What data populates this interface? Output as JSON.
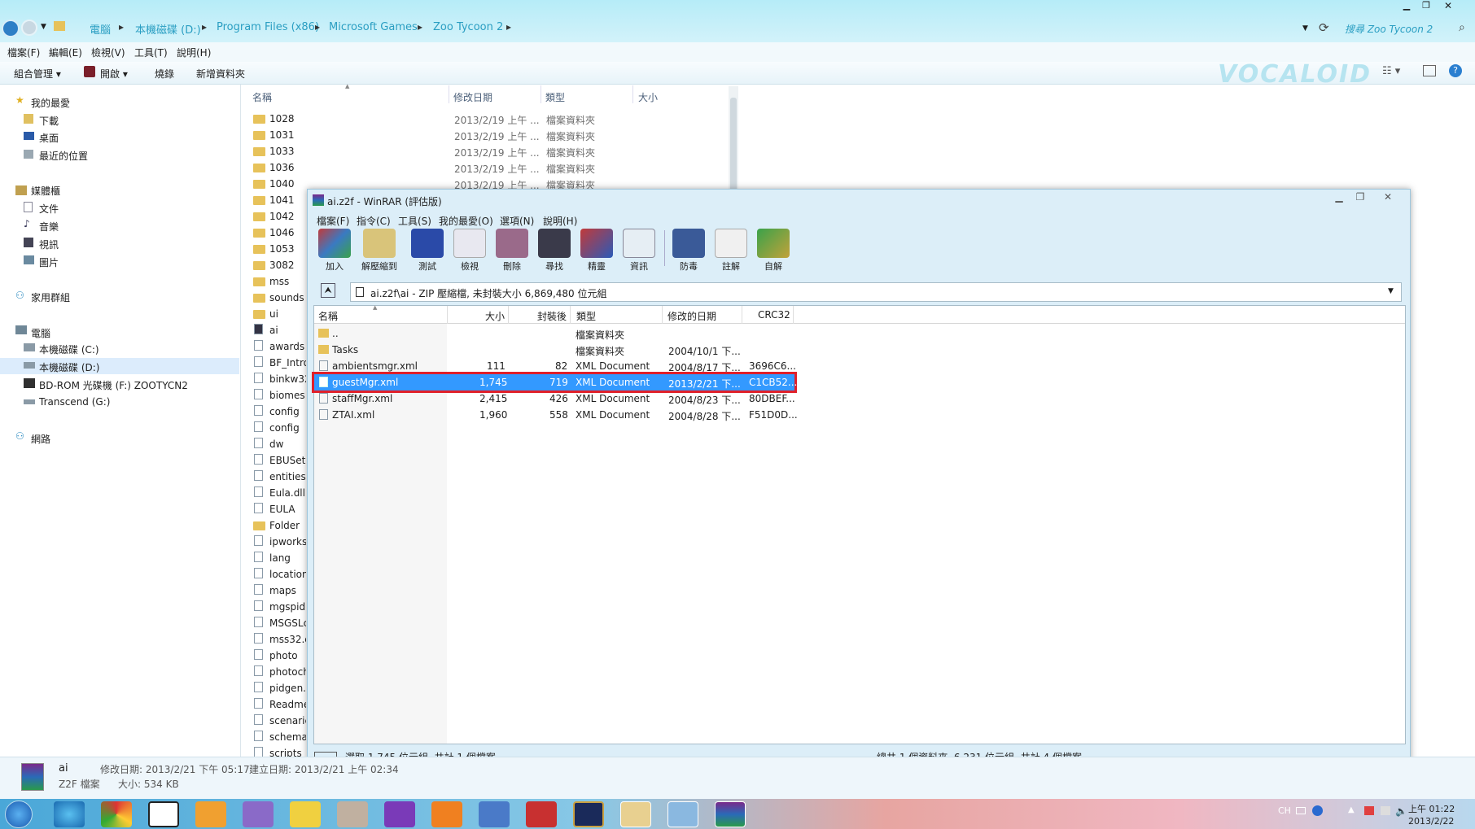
{
  "explorer": {
    "breadcrumb": [
      "電腦",
      "本機磁碟 (D:)",
      "Program Files (x86)",
      "Microsoft Games",
      "Zoo Tycoon 2"
    ],
    "search_placeholder": "搜尋 Zoo Tycoon 2",
    "menu": [
      "檔案(F)",
      "編輯(E)",
      "檢視(V)",
      "工具(T)",
      "說明(H)"
    ],
    "toolbar": {
      "organize": "組合管理",
      "open": "開啟",
      "burn": "燒錄",
      "new_folder": "新增資料夾"
    },
    "nav": {
      "favorites": "我的最愛",
      "downloads": "下載",
      "desktop": "桌面",
      "recent": "最近的位置",
      "libraries": "媒體櫃",
      "documents": "文件",
      "music": "音樂",
      "videos": "視訊",
      "pictures": "圖片",
      "homegroup": "家用群組",
      "computer": "電腦",
      "drive_c": "本機磁碟 (C:)",
      "drive_d": "本機磁碟 (D:)",
      "drive_f": "BD-ROM 光碟機 (F:) ZOOTYCN2",
      "drive_g": "Transcend (G:)",
      "network": "網路"
    },
    "columns": {
      "name": "名稱",
      "date": "修改日期",
      "type": "類型",
      "size": "大小"
    },
    "files": [
      {
        "name": "1028",
        "date": "2013/2/19 上午 ...",
        "type": "檔案資料夾"
      },
      {
        "name": "1031",
        "date": "2013/2/19 上午 ...",
        "type": "檔案資料夾"
      },
      {
        "name": "1033",
        "date": "2013/2/19 上午 ...",
        "type": "檔案資料夾"
      },
      {
        "name": "1036",
        "date": "2013/2/19 上午 ...",
        "type": "檔案資料夾"
      },
      {
        "name": "1040",
        "date": "2013/2/19 上午 ...",
        "type": "檔案資料夾"
      },
      {
        "name": "1041"
      },
      {
        "name": "1042"
      },
      {
        "name": "1046"
      },
      {
        "name": "1053"
      },
      {
        "name": "3082"
      },
      {
        "name": "mss"
      },
      {
        "name": "sounds"
      },
      {
        "name": "ui"
      },
      {
        "name": "ai"
      },
      {
        "name": "awards"
      },
      {
        "name": "BF_Intro"
      },
      {
        "name": "binkw32"
      },
      {
        "name": "biomes"
      },
      {
        "name": "config"
      },
      {
        "name": "config"
      },
      {
        "name": "dw"
      },
      {
        "name": "EBUSetu"
      },
      {
        "name": "entities"
      },
      {
        "name": "Eula.dll"
      },
      {
        "name": "EULA"
      },
      {
        "name": "Folder"
      },
      {
        "name": "ipworks"
      },
      {
        "name": "lang"
      },
      {
        "name": "location"
      },
      {
        "name": "maps"
      },
      {
        "name": "mgspid."
      },
      {
        "name": "MSGSLc"
      },
      {
        "name": "mss32.d"
      },
      {
        "name": "photo"
      },
      {
        "name": "photoch"
      },
      {
        "name": "pidgen."
      },
      {
        "name": "Readme"
      },
      {
        "name": "scenaric"
      },
      {
        "name": "schema"
      },
      {
        "name": "scripts"
      }
    ],
    "details": {
      "name": "ai",
      "type": "Z2F 檔案",
      "modified": "修改日期: 2013/2/21 下午 05:17",
      "created": "建立日期: 2013/2/21 上午 02:34",
      "size": "大小: 534 KB"
    }
  },
  "winrar": {
    "title": "ai.z2f - WinRAR (評估版)",
    "menu": [
      "檔案(F)",
      "指令(C)",
      "工具(S)",
      "我的最愛(O)",
      "選項(N)",
      "說明(H)"
    ],
    "tools": [
      "加入",
      "解壓縮到",
      "測試",
      "檢視",
      "刪除",
      "尋找",
      "精靈",
      "資訊",
      "防毒",
      "註解",
      "自解"
    ],
    "path": "ai.z2f\\ai - ZIP 壓縮檔, 未封裝大小 6,869,480 位元組",
    "columns": {
      "name": "名稱",
      "size": "大小",
      "packed": "封裝後",
      "type": "類型",
      "modified": "修改的日期",
      "crc": "CRC32"
    },
    "rows": [
      {
        "name": "..",
        "size": "",
        "packed": "",
        "type": "檔案資料夾",
        "modified": "",
        "crc": ""
      },
      {
        "name": "Tasks",
        "size": "",
        "packed": "",
        "type": "檔案資料夾",
        "modified": "2004/10/1 下...",
        "crc": ""
      },
      {
        "name": "ambientsmgr.xml",
        "size": "111",
        "packed": "82",
        "type": "XML Document",
        "modified": "2004/8/17 下...",
        "crc": "3696C6..."
      },
      {
        "name": "guestMgr.xml",
        "size": "1,745",
        "packed": "719",
        "type": "XML Document",
        "modified": "2013/2/21 下...",
        "crc": "C1CB52..."
      },
      {
        "name": "staffMgr.xml",
        "size": "2,415",
        "packed": "426",
        "type": "XML Document",
        "modified": "2004/8/23 下...",
        "crc": "80DBEF..."
      },
      {
        "name": "ZTAI.xml",
        "size": "1,960",
        "packed": "558",
        "type": "XML Document",
        "modified": "2004/8/28 下...",
        "crc": "F51D0D..."
      }
    ],
    "status_left": "選取 1,745 位元組, 共計 1 個檔案",
    "status_right": "總共 1 個資料夾, 6,231 位元組, 共計 4 個檔案"
  },
  "taskbar": {
    "lang": "CH",
    "time": "上午 01:22",
    "date": "2013/2/22"
  },
  "watermark": "VOCALOID",
  "colors": {
    "selection": "#3399ff",
    "highlight_border": "#e0202a",
    "accent": "#2a9ec2"
  }
}
